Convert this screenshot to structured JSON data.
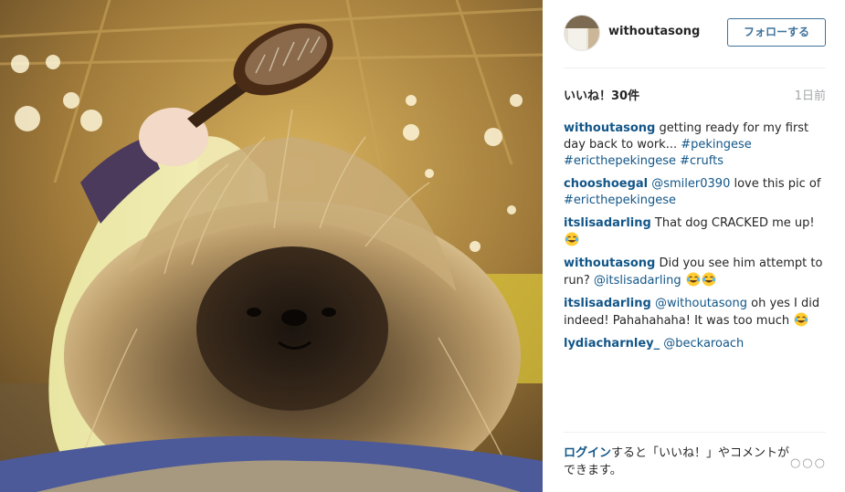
{
  "post": {
    "username": "withoutasong",
    "follow_label": "フォローする",
    "likes_text": "いいね！30件",
    "time_ago": "1日前"
  },
  "comments": [
    {
      "user": "withoutasong",
      "parts": [
        {
          "type": "text",
          "value": " getting ready for my first day back to work... "
        },
        {
          "type": "tag",
          "value": "#pekingese"
        },
        {
          "type": "text",
          "value": " "
        },
        {
          "type": "tag",
          "value": "#ericthepekingese"
        },
        {
          "type": "text",
          "value": " "
        },
        {
          "type": "tag",
          "value": "#crufts"
        }
      ]
    },
    {
      "user": "chooshoegal",
      "parts": [
        {
          "type": "text",
          "value": " "
        },
        {
          "type": "mention",
          "value": "@smiler0390"
        },
        {
          "type": "text",
          "value": " love this pic of "
        },
        {
          "type": "tag",
          "value": "#ericthepekingese"
        }
      ]
    },
    {
      "user": "itslisadarling",
      "parts": [
        {
          "type": "text",
          "value": " That dog CRACKED me up! "
        },
        {
          "type": "emoji",
          "value": "joy-emoji"
        }
      ]
    },
    {
      "user": "withoutasong",
      "parts": [
        {
          "type": "text",
          "value": " Did you see him attempt to run? "
        },
        {
          "type": "mention",
          "value": "@itslisadarling"
        },
        {
          "type": "text",
          "value": " "
        },
        {
          "type": "emoji",
          "value": "joy-emoji"
        },
        {
          "type": "emoji",
          "value": "joy-emoji"
        }
      ]
    },
    {
      "user": "itslisadarling",
      "parts": [
        {
          "type": "text",
          "value": " "
        },
        {
          "type": "mention",
          "value": "@withoutasong"
        },
        {
          "type": "text",
          "value": " oh yes I did indeed! Pahahahaha! It was too much "
        },
        {
          "type": "emoji",
          "value": "joy-emoji"
        }
      ]
    },
    {
      "user": "lydiacharnley_",
      "parts": [
        {
          "type": "text",
          "value": " "
        },
        {
          "type": "mention",
          "value": "@beckaroach"
        }
      ]
    }
  ],
  "footer": {
    "login_link": "ログイン",
    "login_rest": "すると「いいね！」やコメントができます。",
    "more_label": "○○○"
  },
  "colors": {
    "link": "#125688",
    "follow_border": "#3f729b",
    "muted": "#a5a7aa"
  }
}
